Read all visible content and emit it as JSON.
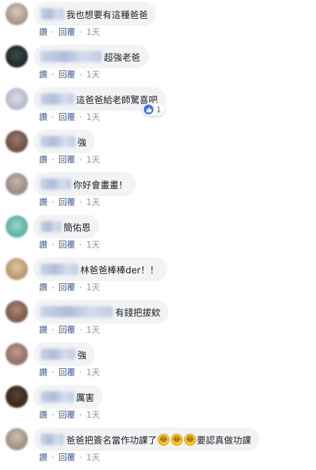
{
  "actions": {
    "like": "讚",
    "reply": "回覆",
    "separator": "·"
  },
  "colors": {
    "bubble": "#f2f3f5",
    "link": "#385898",
    "meta": "#90949c",
    "like_blue": "#3578e5"
  },
  "comments": [
    {
      "text": "我也想要有這種爸爸",
      "time": "1天"
    },
    {
      "text": "超強老爸",
      "time": "1天"
    },
    {
      "text": "這爸爸給老師驚喜吧",
      "time": "1天",
      "reactions": {
        "icon": "like-icon",
        "count": "1"
      }
    },
    {
      "text": "強",
      "time": "1天"
    },
    {
      "text": "你好會畫畫！",
      "time": "1天"
    },
    {
      "text": "簡佑恩",
      "time": "1天"
    },
    {
      "text": "林爸爸棒棒der！！",
      "time": "1天"
    },
    {
      "text": "有錢把拔欸",
      "time": "1天"
    },
    {
      "text": "強",
      "time": "1天"
    },
    {
      "text": "厲害",
      "time": "1天"
    },
    {
      "text_before": "爸爸把簽名當作功課了",
      "emoji": [
        "😂",
        "😂",
        "😂"
      ],
      "text_after": "要認真做功課",
      "time": "1天"
    }
  ]
}
